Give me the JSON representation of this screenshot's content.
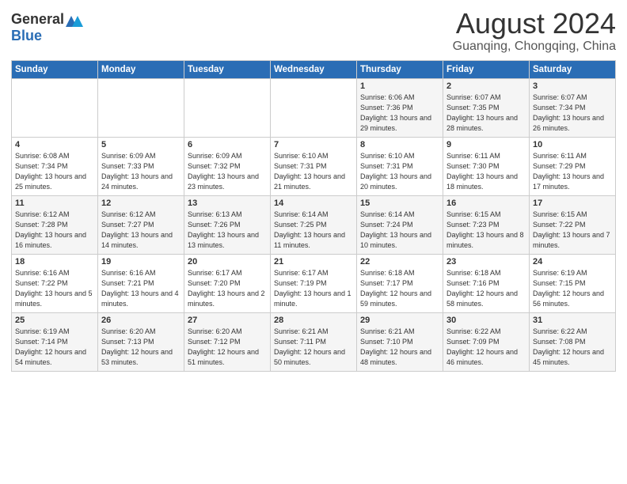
{
  "logo": {
    "general": "General",
    "blue": "Blue"
  },
  "title": "August 2024",
  "location": "Guanqing, Chongqing, China",
  "days_of_week": [
    "Sunday",
    "Monday",
    "Tuesday",
    "Wednesday",
    "Thursday",
    "Friday",
    "Saturday"
  ],
  "weeks": [
    [
      {
        "day": "",
        "info": ""
      },
      {
        "day": "",
        "info": ""
      },
      {
        "day": "",
        "info": ""
      },
      {
        "day": "",
        "info": ""
      },
      {
        "day": "1",
        "info": "Sunrise: 6:06 AM\nSunset: 7:36 PM\nDaylight: 13 hours\nand 29 minutes."
      },
      {
        "day": "2",
        "info": "Sunrise: 6:07 AM\nSunset: 7:35 PM\nDaylight: 13 hours\nand 28 minutes."
      },
      {
        "day": "3",
        "info": "Sunrise: 6:07 AM\nSunset: 7:34 PM\nDaylight: 13 hours\nand 26 minutes."
      }
    ],
    [
      {
        "day": "4",
        "info": "Sunrise: 6:08 AM\nSunset: 7:34 PM\nDaylight: 13 hours\nand 25 minutes."
      },
      {
        "day": "5",
        "info": "Sunrise: 6:09 AM\nSunset: 7:33 PM\nDaylight: 13 hours\nand 24 minutes."
      },
      {
        "day": "6",
        "info": "Sunrise: 6:09 AM\nSunset: 7:32 PM\nDaylight: 13 hours\nand 23 minutes."
      },
      {
        "day": "7",
        "info": "Sunrise: 6:10 AM\nSunset: 7:31 PM\nDaylight: 13 hours\nand 21 minutes."
      },
      {
        "day": "8",
        "info": "Sunrise: 6:10 AM\nSunset: 7:31 PM\nDaylight: 13 hours\nand 20 minutes."
      },
      {
        "day": "9",
        "info": "Sunrise: 6:11 AM\nSunset: 7:30 PM\nDaylight: 13 hours\nand 18 minutes."
      },
      {
        "day": "10",
        "info": "Sunrise: 6:11 AM\nSunset: 7:29 PM\nDaylight: 13 hours\nand 17 minutes."
      }
    ],
    [
      {
        "day": "11",
        "info": "Sunrise: 6:12 AM\nSunset: 7:28 PM\nDaylight: 13 hours\nand 16 minutes."
      },
      {
        "day": "12",
        "info": "Sunrise: 6:12 AM\nSunset: 7:27 PM\nDaylight: 13 hours\nand 14 minutes."
      },
      {
        "day": "13",
        "info": "Sunrise: 6:13 AM\nSunset: 7:26 PM\nDaylight: 13 hours\nand 13 minutes."
      },
      {
        "day": "14",
        "info": "Sunrise: 6:14 AM\nSunset: 7:25 PM\nDaylight: 13 hours\nand 11 minutes."
      },
      {
        "day": "15",
        "info": "Sunrise: 6:14 AM\nSunset: 7:24 PM\nDaylight: 13 hours\nand 10 minutes."
      },
      {
        "day": "16",
        "info": "Sunrise: 6:15 AM\nSunset: 7:23 PM\nDaylight: 13 hours\nand 8 minutes."
      },
      {
        "day": "17",
        "info": "Sunrise: 6:15 AM\nSunset: 7:22 PM\nDaylight: 13 hours\nand 7 minutes."
      }
    ],
    [
      {
        "day": "18",
        "info": "Sunrise: 6:16 AM\nSunset: 7:22 PM\nDaylight: 13 hours\nand 5 minutes."
      },
      {
        "day": "19",
        "info": "Sunrise: 6:16 AM\nSunset: 7:21 PM\nDaylight: 13 hours\nand 4 minutes."
      },
      {
        "day": "20",
        "info": "Sunrise: 6:17 AM\nSunset: 7:20 PM\nDaylight: 13 hours\nand 2 minutes."
      },
      {
        "day": "21",
        "info": "Sunrise: 6:17 AM\nSunset: 7:19 PM\nDaylight: 13 hours\nand 1 minute."
      },
      {
        "day": "22",
        "info": "Sunrise: 6:18 AM\nSunset: 7:17 PM\nDaylight: 12 hours\nand 59 minutes."
      },
      {
        "day": "23",
        "info": "Sunrise: 6:18 AM\nSunset: 7:16 PM\nDaylight: 12 hours\nand 58 minutes."
      },
      {
        "day": "24",
        "info": "Sunrise: 6:19 AM\nSunset: 7:15 PM\nDaylight: 12 hours\nand 56 minutes."
      }
    ],
    [
      {
        "day": "25",
        "info": "Sunrise: 6:19 AM\nSunset: 7:14 PM\nDaylight: 12 hours\nand 54 minutes."
      },
      {
        "day": "26",
        "info": "Sunrise: 6:20 AM\nSunset: 7:13 PM\nDaylight: 12 hours\nand 53 minutes."
      },
      {
        "day": "27",
        "info": "Sunrise: 6:20 AM\nSunset: 7:12 PM\nDaylight: 12 hours\nand 51 minutes."
      },
      {
        "day": "28",
        "info": "Sunrise: 6:21 AM\nSunset: 7:11 PM\nDaylight: 12 hours\nand 50 minutes."
      },
      {
        "day": "29",
        "info": "Sunrise: 6:21 AM\nSunset: 7:10 PM\nDaylight: 12 hours\nand 48 minutes."
      },
      {
        "day": "30",
        "info": "Sunrise: 6:22 AM\nSunset: 7:09 PM\nDaylight: 12 hours\nand 46 minutes."
      },
      {
        "day": "31",
        "info": "Sunrise: 6:22 AM\nSunset: 7:08 PM\nDaylight: 12 hours\nand 45 minutes."
      }
    ]
  ]
}
